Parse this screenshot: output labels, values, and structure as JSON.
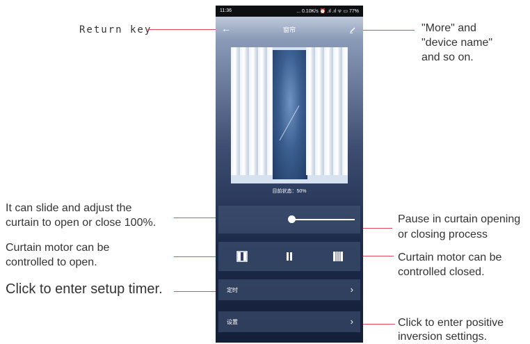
{
  "phone": {
    "status_time": "11:36",
    "status_right": "... 0.10K/s ⏰ .ıl .ıl ᯤ ▭ 77%",
    "title": "窗帘",
    "back_icon": "arrow-left-icon",
    "edit_icon": "pencil-icon",
    "state_text": "目前状态：50%",
    "slider_value_percent": 50,
    "buttons": {
      "open_icon": "curtain-open-icon",
      "pause_icon": "pause-icon",
      "close_icon": "curtain-close-icon"
    },
    "menu": {
      "timer_label": "定时",
      "settings_label": "设置",
      "chevron": "›"
    }
  },
  "annotations": {
    "return_key": "Return key",
    "more_device_name": [
      "\"More\" and",
      "\"device name\"",
      "and so on."
    ],
    "slide_adjust": [
      "It can slide and adjust the",
      "curtain to open or close 100%."
    ],
    "motor_open": [
      "Curtain motor can be",
      "controlled to open."
    ],
    "setup_timer": "Click to enter setup timer.",
    "pause": [
      "Pause in curtain opening",
      "or closing process"
    ],
    "motor_closed": [
      "Curtain motor can be",
      "controlled closed."
    ],
    "inversion": [
      "Click to enter positive",
      "inversion settings."
    ]
  },
  "colors": {
    "annotation_line": "#e24a5a",
    "annotation_text": "#333333",
    "phone_dark": "#141f38"
  }
}
